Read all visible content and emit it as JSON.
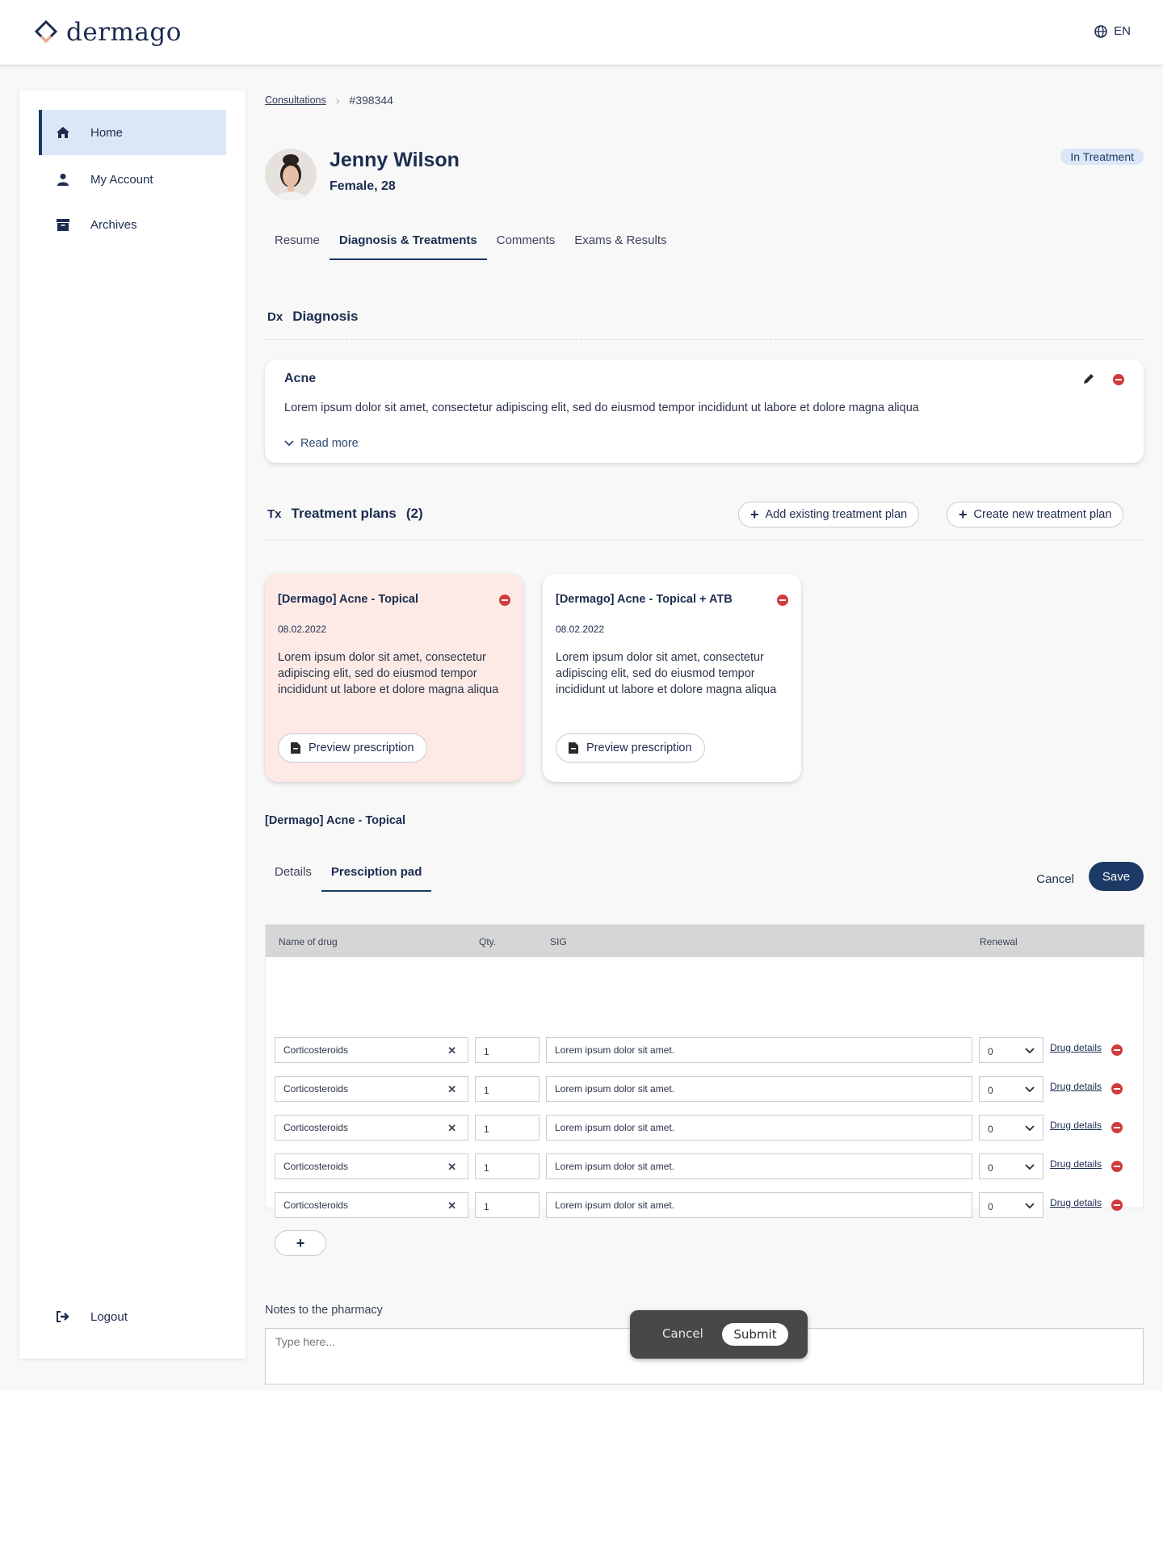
{
  "brand": {
    "name": "dermago"
  },
  "header": {
    "lang": "EN"
  },
  "sidebar": {
    "items": [
      {
        "label": "Home",
        "icon": "home-icon",
        "active": true
      },
      {
        "label": "My Account",
        "icon": "user-icon"
      },
      {
        "label": "Archives",
        "icon": "archive-icon"
      }
    ],
    "logout": "Logout"
  },
  "breadcrumb": {
    "parent": "Consultations",
    "current": "#398344"
  },
  "patient": {
    "name": "Jenny Wilson",
    "meta": "Female, 28",
    "status": "In Treatment"
  },
  "tabs": [
    "Resume",
    "Diagnosis & Treatments",
    "Comments",
    "Exams & Results"
  ],
  "diagnosis": {
    "tag": "Dx",
    "heading": "Diagnosis",
    "card": {
      "title": "Acne",
      "text": "Lorem ipsum dolor sit amet, consectetur adipiscing elit, sed do eiusmod tempor incididunt ut labore et dolore magna aliqua",
      "more": "Read more"
    }
  },
  "treatments": {
    "tag": "Tx",
    "heading": "Treatment plans",
    "count": "(2)",
    "add_existing": "Add existing treatment plan",
    "create_new": "Create new treatment plan",
    "plans": [
      {
        "title": "[Dermago] Acne - Topical",
        "date": "08.02.2022",
        "desc": "Lorem ipsum dolor sit amet, consectetur adipiscing elit, sed do eiusmod tempor incididunt ut labore et dolore magna aliqua",
        "preview": "Preview prescription"
      },
      {
        "title": "[Dermago] Acne - Topical + ATB",
        "date": "08.02.2022",
        "desc": "Lorem ipsum dolor sit amet, consectetur adipiscing elit, sed do eiusmod tempor incididunt ut labore et dolore magna aliqua",
        "preview": "Preview prescription"
      }
    ]
  },
  "plan_detail": {
    "title": "[Dermago] Acne - Topical",
    "tabs": [
      "Details",
      "Presciption pad"
    ],
    "cancel": "Cancel",
    "save": "Save"
  },
  "prescription": {
    "columns": [
      "Name of drug",
      "Qty.",
      "SIG",
      "Renewal"
    ],
    "rows": [
      {
        "drug": "Corticosteroids",
        "qty": "1",
        "sig": "Lorem ipsum dolor sit amet.",
        "renewal": "0",
        "details": "Drug details"
      },
      {
        "drug": "Corticosteroids",
        "qty": "1",
        "sig": "Lorem ipsum dolor sit amet.",
        "renewal": "0",
        "details": "Drug details"
      },
      {
        "drug": "Corticosteroids",
        "qty": "1",
        "sig": "Lorem ipsum dolor sit amet.",
        "renewal": "0",
        "details": "Drug details"
      },
      {
        "drug": "Corticosteroids",
        "qty": "1",
        "sig": "Lorem ipsum dolor sit amet.",
        "renewal": "0",
        "details": "Drug details"
      },
      {
        "drug": "Corticosteroids",
        "qty": "1",
        "sig": "Lorem ipsum dolor sit amet.",
        "renewal": "0",
        "details": "Drug details"
      }
    ],
    "add": "+"
  },
  "notes": {
    "label": "Notes to the pharmacy",
    "placeholder": "Type here..."
  },
  "footer": {
    "cancel": "Cancel",
    "submit": "Submit"
  },
  "colors": {
    "primary": "#1d3a66",
    "active_bg": "#dbe7f6",
    "selected_card": "#fdeae6",
    "danger": "#d03b3b"
  }
}
